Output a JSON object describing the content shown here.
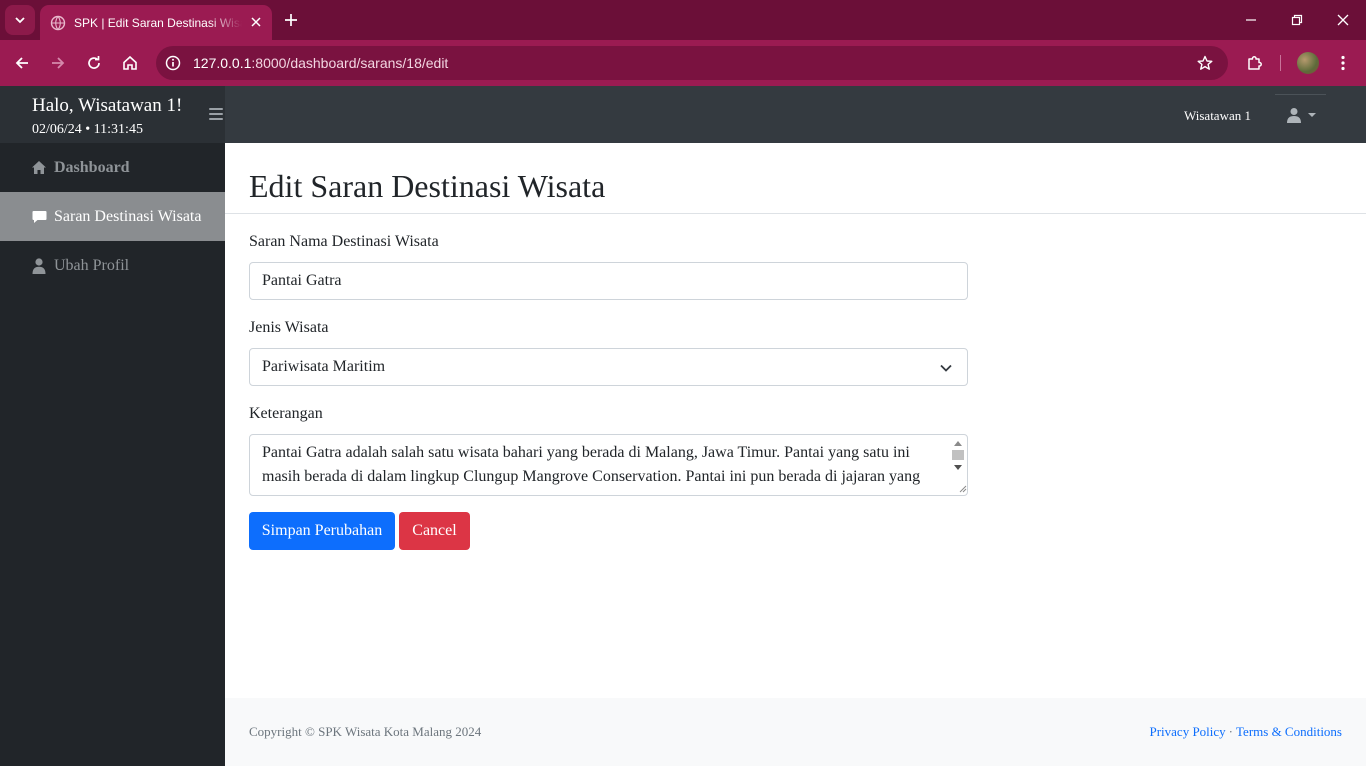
{
  "browser": {
    "tab_title": "SPK | Edit Saran Destinasi Wisata",
    "url_host": "127.0.0.1",
    "url_rest": ":8000/dashboard/sarans/18/edit"
  },
  "header": {
    "greeting": "Halo, Wisatawan 1!",
    "datetime": "02/06/24 • 11:31:45",
    "user_name": "Wisatawan 1"
  },
  "sidebar": {
    "items": [
      {
        "label": "Dashboard",
        "icon": "home-icon"
      },
      {
        "label": "Saran Destinasi Wisata",
        "icon": "comment-icon"
      },
      {
        "label": "Ubah Profil",
        "icon": "user-icon"
      }
    ]
  },
  "main": {
    "title": "Edit Saran Destinasi Wisata",
    "fields": {
      "name_label": "Saran Nama Destinasi Wisata",
      "name_value": "Pantai Gatra",
      "type_label": "Jenis Wisata",
      "type_value": "Pariwisata Maritim",
      "notes_label": "Keterangan",
      "notes_value": "Pantai Gatra adalah salah satu wisata bahari yang berada di Malang, Jawa Timur. Pantai yang satu ini masih berada di dalam lingkup Clungup Mangrove Conservation. Pantai ini pun berada di jajaran yang"
    },
    "buttons": {
      "save": "Simpan Perubahan",
      "cancel": "Cancel"
    }
  },
  "footer": {
    "copyright": "Copyright © SPK Wisata Kota Malang 2024",
    "privacy": "Privacy Policy",
    "separator": "·",
    "terms": "Terms & Conditions"
  },
  "colors": {
    "chrome_tabstrip": "#6b0f38",
    "chrome_toolbar": "#9b1b52",
    "topbar": "#343a40",
    "sidebar": "#212529",
    "sidebar_active": "#8a8d90",
    "primary": "#0d6efd",
    "danger": "#dc3545"
  }
}
